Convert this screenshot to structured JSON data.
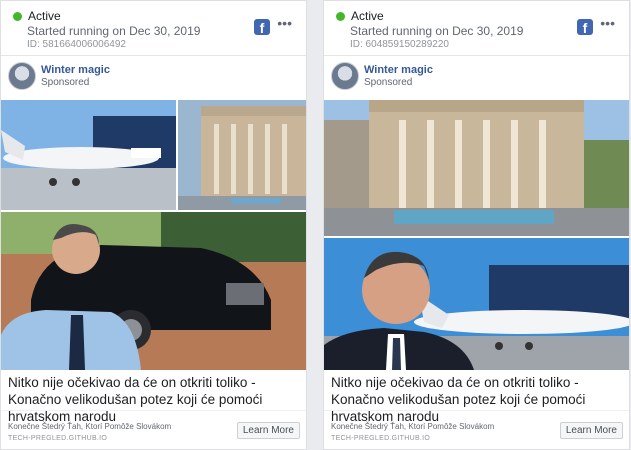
{
  "ads": [
    {
      "status": "Active",
      "started": "Started running on Dec 30, 2019",
      "id": "ID: 581664006006492",
      "page_name": "Winter magic",
      "sponsored": "Sponsored",
      "headline": "Nitko nije očekivao da će on otkriti toliko - Konačno velikodušan potez koji će pomoći hrvatskom narodu",
      "description": "Konečne Štedrý Ťah, Ktorí Pomôže Slovákom",
      "domain": "TECH-PREGLED.GITHUB.IO",
      "cta": "Learn More",
      "layout": "collage"
    },
    {
      "status": "Active",
      "started": "Started running on Dec 30, 2019",
      "id": "ID: 604859150289220",
      "page_name": "Winter magic",
      "sponsored": "Sponsored",
      "headline": "Nitko nije očekivao da će on otkriti toliko - Konačno velikodušan potez koji će pomoći hrvatskom narodu",
      "description": "Konečne Štedrý Ťah, Ktorí Pomôže Slovákom",
      "domain": "TECH-PREGLED.GITHUB.IO",
      "cta": "Learn More",
      "layout": "stacked"
    }
  ],
  "icons": {
    "platform": "facebook-icon",
    "menu": "more-options-icon"
  },
  "colors": {
    "active": "#42b72a",
    "facebook_blue": "#4267b2",
    "link": "#365899"
  }
}
